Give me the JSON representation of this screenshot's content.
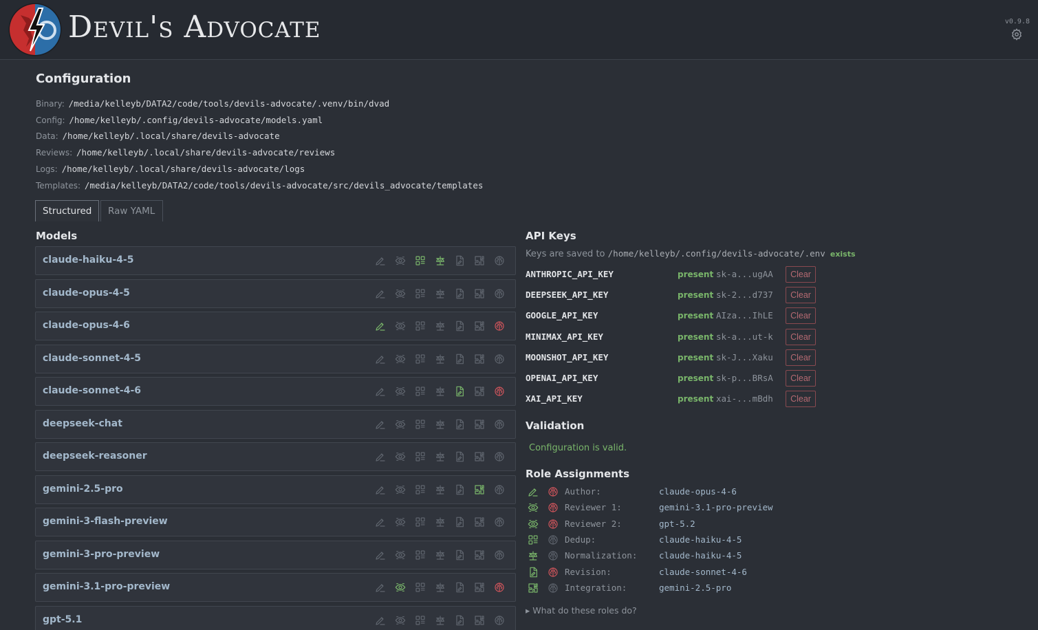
{
  "header": {
    "app_title": "Devil's Advocate",
    "version": "v0.9.8",
    "settings_icon": "gear-icon"
  },
  "configuration": {
    "title": "Configuration",
    "paths": [
      {
        "label": "Binary:",
        "value": "/media/kelleyb/DATA2/code/tools/devils-advocate/.venv/bin/dvad"
      },
      {
        "label": "Config:",
        "value": "/home/kelleyb/.config/devils-advocate/models.yaml"
      },
      {
        "label": "Data:",
        "value": "/home/kelleyb/.local/share/devils-advocate"
      },
      {
        "label": "Reviews:",
        "value": "/home/kelleyb/.local/share/devils-advocate/reviews"
      },
      {
        "label": "Logs:",
        "value": "/home/kelleyb/.local/share/devils-advocate/logs"
      },
      {
        "label": "Templates:",
        "value": "/media/kelleyb/DATA2/code/tools/devils-advocate/src/devils_advocate/templates"
      }
    ],
    "tabs": [
      {
        "label": "Structured",
        "active": true
      },
      {
        "label": "Raw YAML",
        "active": false
      }
    ]
  },
  "models": {
    "title": "Models",
    "role_icon_names": [
      "author-icon",
      "reviewer-icon",
      "dedup-icon",
      "normalization-icon",
      "revision-icon",
      "integration-icon",
      "thinking-icon"
    ],
    "items": [
      {
        "name": "claude-haiku-4-5",
        "roles": [
          false,
          false,
          true,
          true,
          false,
          false,
          false
        ]
      },
      {
        "name": "claude-opus-4-5",
        "roles": [
          false,
          false,
          false,
          false,
          false,
          false,
          false
        ]
      },
      {
        "name": "claude-opus-4-6",
        "roles": [
          true,
          false,
          false,
          false,
          false,
          false,
          true
        ]
      },
      {
        "name": "claude-sonnet-4-5",
        "roles": [
          false,
          false,
          false,
          false,
          false,
          false,
          false
        ]
      },
      {
        "name": "claude-sonnet-4-6",
        "roles": [
          false,
          false,
          false,
          false,
          true,
          false,
          true
        ]
      },
      {
        "name": "deepseek-chat",
        "roles": [
          false,
          false,
          false,
          false,
          false,
          false,
          false
        ]
      },
      {
        "name": "deepseek-reasoner",
        "roles": [
          false,
          false,
          false,
          false,
          false,
          false,
          false
        ]
      },
      {
        "name": "gemini-2.5-pro",
        "roles": [
          false,
          false,
          false,
          false,
          false,
          true,
          false
        ]
      },
      {
        "name": "gemini-3-flash-preview",
        "roles": [
          false,
          false,
          false,
          false,
          false,
          false,
          false
        ]
      },
      {
        "name": "gemini-3-pro-preview",
        "roles": [
          false,
          false,
          false,
          false,
          false,
          false,
          false
        ]
      },
      {
        "name": "gemini-3.1-pro-preview",
        "roles": [
          false,
          true,
          false,
          false,
          false,
          false,
          true
        ]
      },
      {
        "name": "gpt-5.1",
        "roles": [
          false,
          false,
          false,
          false,
          false,
          false,
          false
        ]
      }
    ]
  },
  "api_keys": {
    "title": "API Keys",
    "note_prefix": "Keys are saved to",
    "path": "/home/kelleyb/.config/devils-advocate/.env",
    "exists_label": "exists",
    "clear_label": "Clear",
    "items": [
      {
        "name": "ANTHROPIC_API_KEY",
        "status": "present",
        "masked": "sk-a...ugAA"
      },
      {
        "name": "DEEPSEEK_API_KEY",
        "status": "present",
        "masked": "sk-2...d737"
      },
      {
        "name": "GOOGLE_API_KEY",
        "status": "present",
        "masked": "AIza...IhLE"
      },
      {
        "name": "MINIMAX_API_KEY",
        "status": "present",
        "masked": "sk-a...ut-k"
      },
      {
        "name": "MOONSHOT_API_KEY",
        "status": "present",
        "masked": "sk-J...Xaku"
      },
      {
        "name": "OPENAI_API_KEY",
        "status": "present",
        "masked": "sk-p...BRsA"
      },
      {
        "name": "XAI_API_KEY",
        "status": "present",
        "masked": "xai-...mBdh"
      }
    ]
  },
  "validation": {
    "title": "Validation",
    "message": "Configuration is valid."
  },
  "role_assignments": {
    "title": "Role Assignments",
    "items": [
      {
        "role": "Author:",
        "model": "claude-opus-4-6",
        "icon": "author-icon",
        "thinking": true
      },
      {
        "role": "Reviewer 1:",
        "model": "gemini-3.1-pro-preview",
        "icon": "reviewer-icon",
        "thinking": true
      },
      {
        "role": "Reviewer 2:",
        "model": "gpt-5.2",
        "icon": "reviewer-icon",
        "thinking": true
      },
      {
        "role": "Dedup:",
        "model": "claude-haiku-4-5",
        "icon": "dedup-icon",
        "thinking": false
      },
      {
        "role": "Normalization:",
        "model": "claude-haiku-4-5",
        "icon": "normalization-icon",
        "thinking": false
      },
      {
        "role": "Revision:",
        "model": "claude-sonnet-4-6",
        "icon": "revision-icon",
        "thinking": true
      },
      {
        "role": "Integration:",
        "model": "gemini-2.5-pro",
        "icon": "integration-icon",
        "thinking": false
      }
    ],
    "help_label": "▸ What do these roles do?"
  },
  "colors": {
    "accent_green": "#79b56a",
    "accent_red": "#d2555c",
    "inactive_icon": "#5f656e",
    "model_name": "#a3b8cb"
  }
}
